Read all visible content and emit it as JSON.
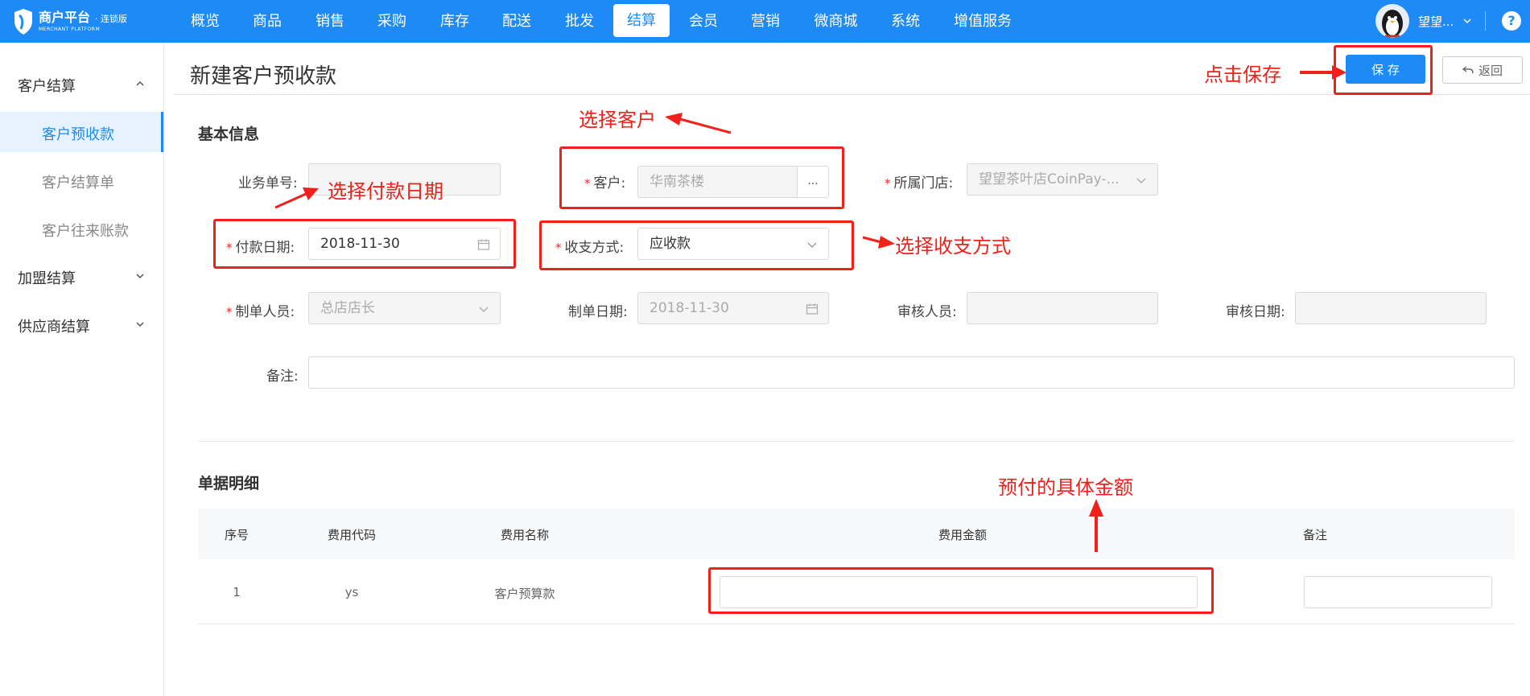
{
  "app": {
    "logo_title": "商户平台",
    "logo_edition": "· 连锁版",
    "logo_subtitle": "MERCHANT PLATFORM"
  },
  "nav": {
    "items": [
      "概览",
      "商品",
      "销售",
      "采购",
      "库存",
      "配送",
      "批发",
      "结算",
      "会员",
      "营销",
      "微商城",
      "系统",
      "增值服务"
    ],
    "active": "结算"
  },
  "user": {
    "name": "望望...",
    "help": "?"
  },
  "sidebar": {
    "groups": [
      {
        "label": "客户结算",
        "expanded": true,
        "items": [
          "客户预收款",
          "客户结算单",
          "客户往来账款"
        ],
        "active_item": "客户预收款"
      },
      {
        "label": "加盟结算",
        "expanded": false
      },
      {
        "label": "供应商结算",
        "expanded": false
      }
    ]
  },
  "header": {
    "title": "新建客户预收款",
    "save_label": "保 存",
    "back_label": "返回"
  },
  "basic_info": {
    "section_title": "基本信息",
    "fields": {
      "order_no": {
        "label": "业务单号:",
        "value": ""
      },
      "customer": {
        "label": "客户:",
        "value": "华南茶楼",
        "button": "...",
        "required": true
      },
      "store": {
        "label": "所属门店:",
        "value": "望望茶叶店CoinPay-...",
        "required": true
      },
      "pay_date": {
        "label": "付款日期:",
        "value": "2018-11-30",
        "required": true
      },
      "pay_method": {
        "label": "收支方式:",
        "value": "应收款",
        "required": true
      },
      "creator": {
        "label": "制单人员:",
        "value": "总店店长",
        "required": true
      },
      "create_date": {
        "label": "制单日期:",
        "value": "2018-11-30"
      },
      "auditor": {
        "label": "审核人员:",
        "value": ""
      },
      "audit_date": {
        "label": "审核日期:",
        "value": ""
      },
      "remark": {
        "label": "备注:",
        "value": ""
      }
    }
  },
  "detail": {
    "section_title": "单据明细",
    "columns": [
      "序号",
      "费用代码",
      "费用名称",
      "费用金额",
      "备注"
    ],
    "rows": [
      {
        "index": "1",
        "code": "ys",
        "name": "客户预算款",
        "amount": "",
        "remark": ""
      }
    ]
  },
  "annotations": {
    "save": "点击保存",
    "customer": "选择客户",
    "pay_date": "选择付款日期",
    "pay_method": "选择收支方式",
    "amount": "预付的具体金额"
  },
  "colors": {
    "primary": "#1e8af5",
    "annotation_red": "#f0201a",
    "required_star": "#f5222d"
  }
}
